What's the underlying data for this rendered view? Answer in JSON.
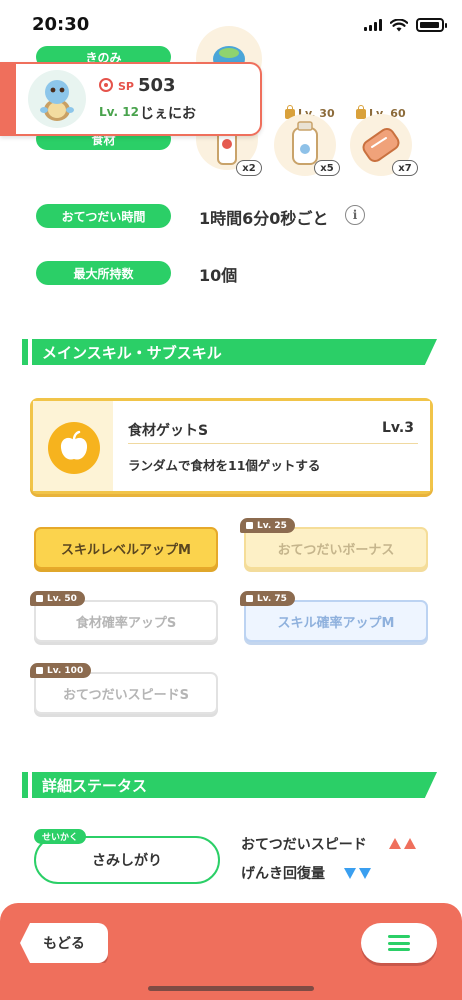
{
  "status_bar": {
    "time": "20:30"
  },
  "top_labels": {
    "berries_label": "きのみ",
    "ingredients_label": "食材"
  },
  "pokemon": {
    "sp_label": "SP",
    "sp_value": "503",
    "level": "Lv. 12",
    "name": "じぇにお"
  },
  "ingredients": [
    {
      "locked": false,
      "lock_level": "",
      "count": "x2"
    },
    {
      "locked": true,
      "lock_level": "Lv. 30",
      "count": "x5"
    },
    {
      "locked": true,
      "lock_level": "Lv. 60",
      "count": "x7"
    }
  ],
  "info_rows": [
    {
      "label": "おてつだい時間",
      "value": "1時間6分0秒ごと"
    },
    {
      "label": "最大所持数",
      "value": "10個"
    }
  ],
  "section_skills": {
    "title": "メインスキル・サブスキル"
  },
  "main_skill": {
    "name": "食材ゲットS",
    "level": "Lv.3",
    "description": "ランダムで食材を11個ゲットする"
  },
  "sub_skills": [
    {
      "label": "スキルレベルアップM",
      "lock_level": "",
      "style": "gold"
    },
    {
      "label": "おてつだいボーナス",
      "lock_level": "Lv. 25",
      "style": "gold-faded"
    },
    {
      "label": "食材確率アップS",
      "lock_level": "Lv. 50",
      "style": "white"
    },
    {
      "label": "スキル確率アップM",
      "lock_level": "Lv. 75",
      "style": "blue"
    },
    {
      "label": "おてつだいスピードS",
      "lock_level": "Lv. 100",
      "style": "white"
    }
  ],
  "section_details": {
    "title": "詳細ステータス"
  },
  "nature": {
    "tag": "せいかく",
    "value": "さみしがり",
    "up_stat": "おてつだいスピード",
    "down_stat": "げんき回復量",
    "colors": {
      "up": "#ef6f5c",
      "down": "#3a9ff0"
    }
  },
  "bottom_bar": {
    "back_label": "もどる"
  },
  "theme": {
    "accent_green": "#2bcf67",
    "accent_coral": "#ef6f5c",
    "gold": "#f1c449"
  }
}
